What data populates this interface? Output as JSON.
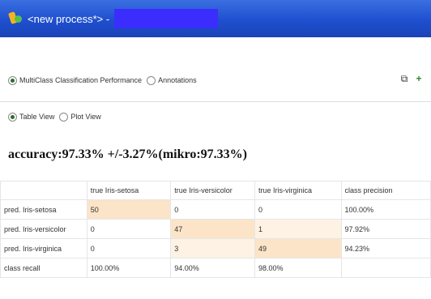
{
  "window": {
    "title": "<new process*> -"
  },
  "view_tabs": {
    "items": [
      {
        "label": "MultiClass Classification Performance",
        "checked": true
      },
      {
        "label": "Annotations",
        "checked": false
      }
    ]
  },
  "display_mode": {
    "items": [
      {
        "label": "Table View",
        "checked": true
      },
      {
        "label": "Plot View",
        "checked": false
      }
    ]
  },
  "toolbar": {
    "icons": [
      "copy-icon",
      "add-icon"
    ]
  },
  "result": {
    "accuracy": "accuracy:97.33% +/-3.27%(mikro:97.33%)"
  },
  "matrix": {
    "headers": [
      "",
      "true Iris-setosa",
      "true Iris-versicolor",
      "true Iris-virginica",
      "class precision"
    ],
    "rows": [
      {
        "label": "pred. Iris-setosa",
        "cells": [
          "50",
          "0",
          "0"
        ],
        "precision": "100.00%"
      },
      {
        "label": "pred. Iris-versicolor",
        "cells": [
          "0",
          "47",
          "1"
        ],
        "precision": "97.92%"
      },
      {
        "label": "pred. Iris-virginica",
        "cells": [
          "0",
          "3",
          "49"
        ],
        "precision": "94.23%"
      }
    ],
    "recall": {
      "label": "class recall",
      "cells": [
        "100.00%",
        "94.00%",
        "98.00%"
      ],
      "last": ""
    }
  },
  "colors": {
    "titlebar": "#1f4fcf",
    "highlight": "#3b2dfd",
    "diagonal": "#fbe4c8"
  }
}
